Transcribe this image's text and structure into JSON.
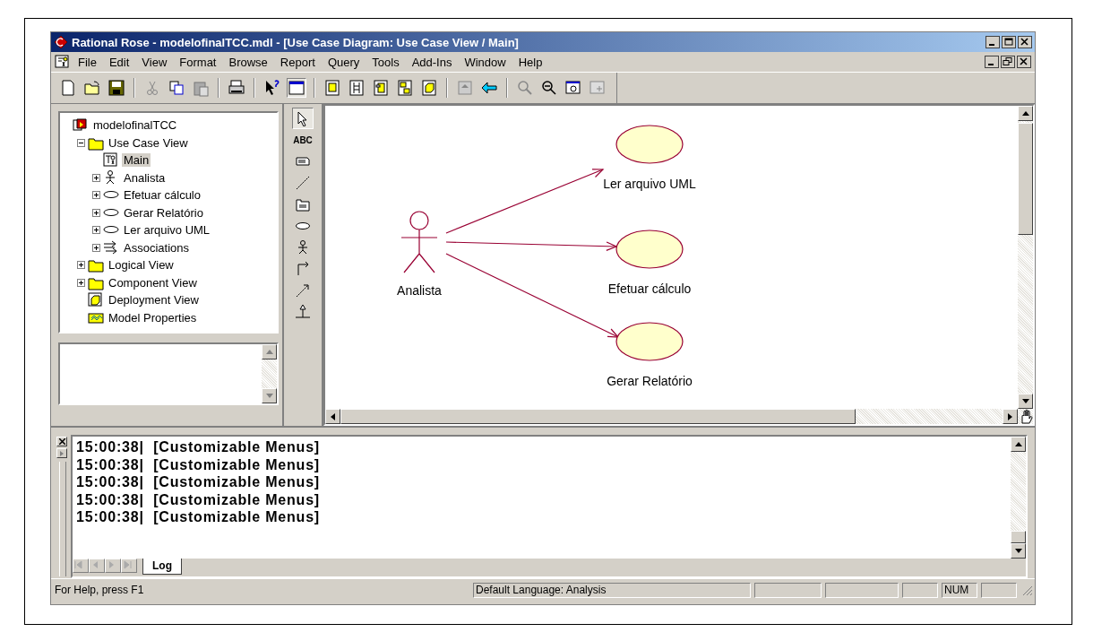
{
  "window": {
    "title": "Rational Rose - modelofinalTCC.mdl - [Use Case Diagram: Use Case View / Main]"
  },
  "menu_bar": [
    "File",
    "Edit",
    "View",
    "Format",
    "Browse",
    "Report",
    "Query",
    "Tools",
    "Add-Ins",
    "Window",
    "Help"
  ],
  "browser_tree": [
    {
      "label": "modelofinalTCC",
      "kind": "model",
      "selected": false,
      "children": [
        {
          "label": "Use Case View",
          "kind": "folder",
          "expanded": true,
          "selected": false,
          "children": [
            {
              "label": "Main",
              "kind": "diagram",
              "selected": true
            },
            {
              "label": "Analista",
              "kind": "actor",
              "expanded": false,
              "selected": false
            },
            {
              "label": "Efetuar cálculo",
              "kind": "usecase",
              "expanded": false,
              "selected": false
            },
            {
              "label": "Gerar Relatório",
              "kind": "usecase",
              "expanded": false,
              "selected": false
            },
            {
              "label": "Ler arquivo UML",
              "kind": "usecase",
              "expanded": false,
              "selected": false
            },
            {
              "label": "Associations",
              "kind": "associations",
              "expanded": false,
              "selected": false
            }
          ]
        },
        {
          "label": "Logical View",
          "kind": "folder",
          "expanded": false,
          "selected": false
        },
        {
          "label": "Component View",
          "kind": "folder",
          "expanded": false,
          "selected": false
        },
        {
          "label": "Deployment View",
          "kind": "deployment",
          "selected": false
        },
        {
          "label": "Model Properties",
          "kind": "properties",
          "selected": false
        }
      ]
    }
  ],
  "toolbox": [
    {
      "kind": "pointer",
      "selected": true
    },
    {
      "kind": "text",
      "label": "ABC",
      "selected": false
    },
    {
      "kind": "note",
      "selected": false
    },
    {
      "kind": "anchor",
      "selected": false
    },
    {
      "kind": "package",
      "selected": false
    },
    {
      "kind": "usecase",
      "selected": false
    },
    {
      "kind": "actor",
      "selected": false
    },
    {
      "kind": "association",
      "selected": false
    },
    {
      "kind": "dependency",
      "selected": false
    },
    {
      "kind": "generalization",
      "selected": false
    }
  ],
  "diagram": {
    "actor": {
      "name": "Analista"
    },
    "use_cases": [
      {
        "name": "Ler arquivo UML"
      },
      {
        "name": "Efetuar cálculo"
      },
      {
        "name": "Gerar Relatório"
      }
    ]
  },
  "log": {
    "lines": [
      {
        "time": "15:00:38|",
        "message": "[Customizable Menus]"
      },
      {
        "time": "15:00:38|",
        "message": "[Customizable Menus]"
      },
      {
        "time": "15:00:38|",
        "message": "[Customizable Menus]"
      },
      {
        "time": "15:00:38|",
        "message": "[Customizable Menus]"
      },
      {
        "time": "15:00:38|",
        "message": "[Customizable Menus]"
      }
    ],
    "tabs": [
      {
        "label": "Log",
        "selected": true
      }
    ]
  },
  "status_bar": {
    "help": "For Help, press F1",
    "language": "Default Language: Analysis",
    "indicator": "NUM"
  }
}
